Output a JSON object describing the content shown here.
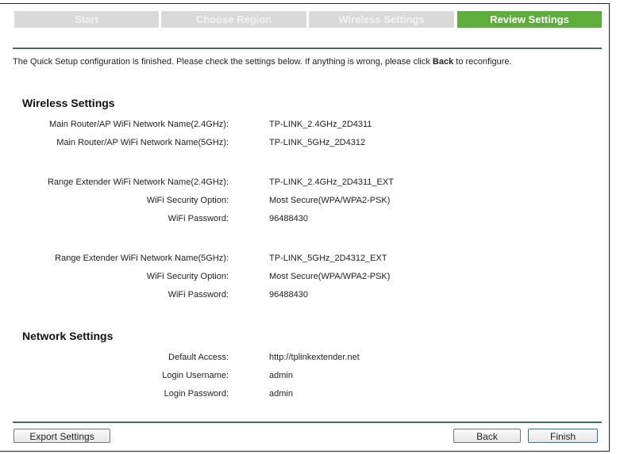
{
  "steps": [
    {
      "label": "Start"
    },
    {
      "label": "Choose Region"
    },
    {
      "label": "Wireless Settings"
    },
    {
      "label": "Review Settings"
    }
  ],
  "intro": {
    "before": "The Quick Setup configuration is finished. Please check the settings below. If anything is wrong, please click ",
    "bold": "Back",
    "after": " to reconfigure."
  },
  "wireless": {
    "title": "Wireless Settings",
    "rows": [
      {
        "label": "Main Router/AP WiFi Network Name(2.4GHz):",
        "value": "TP-LINK_2.4GHz_2D4311"
      },
      {
        "label": "Main Router/AP WiFi Network Name(5GHz):",
        "value": "TP-LINK_5GHz_2D4312"
      },
      {
        "label": "Range Extender WiFi Network Name(2.4GHz):",
        "value": "TP-LINK_2.4GHz_2D4311_EXT"
      },
      {
        "label": "WiFi Security Option:",
        "value": "Most Secure(WPA/WPA2-PSK)"
      },
      {
        "label": "WiFi Password:",
        "value": "96488430"
      },
      {
        "label": "Range Extender WiFi Network Name(5GHz):",
        "value": "TP-LINK_5GHz_2D4312_EXT"
      },
      {
        "label": "WiFi Security Option:",
        "value": "Most Secure(WPA/WPA2-PSK)"
      },
      {
        "label": "WiFi Password:",
        "value": "96488430"
      }
    ]
  },
  "network": {
    "title": "Network Settings",
    "rows": [
      {
        "label": "Default Access:",
        "value": "http://tplinkextender.net"
      },
      {
        "label": "Login Username:",
        "value": "admin"
      },
      {
        "label": "Login Password:",
        "value": "admin"
      }
    ]
  },
  "buttons": {
    "export": "Export Settings",
    "back": "Back",
    "finish": "Finish"
  }
}
